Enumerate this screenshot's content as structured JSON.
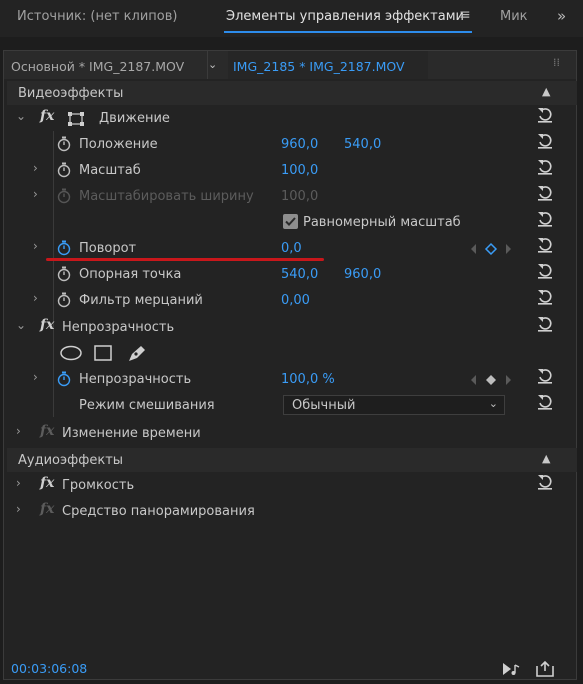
{
  "tabs": {
    "source": "Источник: (нет клипов)",
    "effects": "Элементы управления эффектами",
    "menu_icon": "≡",
    "mixer": "Мик",
    "overflow": "»"
  },
  "clip": {
    "master": "Основной * IMG_2187.MOV",
    "sequence": "IMG_2185 * IMG_2187.MOV"
  },
  "video": {
    "header": "Видеоэффекты",
    "motion": {
      "label": "Движение",
      "position": {
        "label": "Положение",
        "x": "960,0",
        "y": "540,0"
      },
      "scale": {
        "label": "Масштаб",
        "value": "100,0"
      },
      "scale_width": {
        "label": "Масштабировать ширину",
        "value": "100,0"
      },
      "uniform": {
        "label": "Равномерный масштаб",
        "checked": true
      },
      "rotation": {
        "label": "Поворот",
        "value": "0,0"
      },
      "anchor": {
        "label": "Опорная точка",
        "x": "540,0",
        "y": "960,0"
      },
      "flicker": {
        "label": "Фильтр мерцаний",
        "value": "0,00"
      }
    },
    "opacity": {
      "label": "Непрозрачность",
      "value_label": "Непрозрачность",
      "value": "100,0 %",
      "blend_label": "Режим смешивания",
      "blend_value": "Обычный"
    },
    "time_remap": {
      "label": "Изменение времени"
    }
  },
  "audio": {
    "header": "Аудиоэффекты",
    "volume": {
      "label": "Громкость"
    },
    "panner": {
      "label": "Средство панорамирования"
    }
  },
  "footer": {
    "timecode": "00:03:06:08"
  },
  "colors": {
    "accent": "#3a9cf6",
    "annotation": "#c8171b",
    "panel": "#232323"
  },
  "icons": [
    "stopwatch-icon",
    "reset-icon",
    "fx-icon",
    "transform-icon",
    "ellipse-mask-icon",
    "rectangle-mask-icon",
    "pen-mask-icon",
    "keyframe-icon",
    "play-audio-icon",
    "export-icon"
  ]
}
